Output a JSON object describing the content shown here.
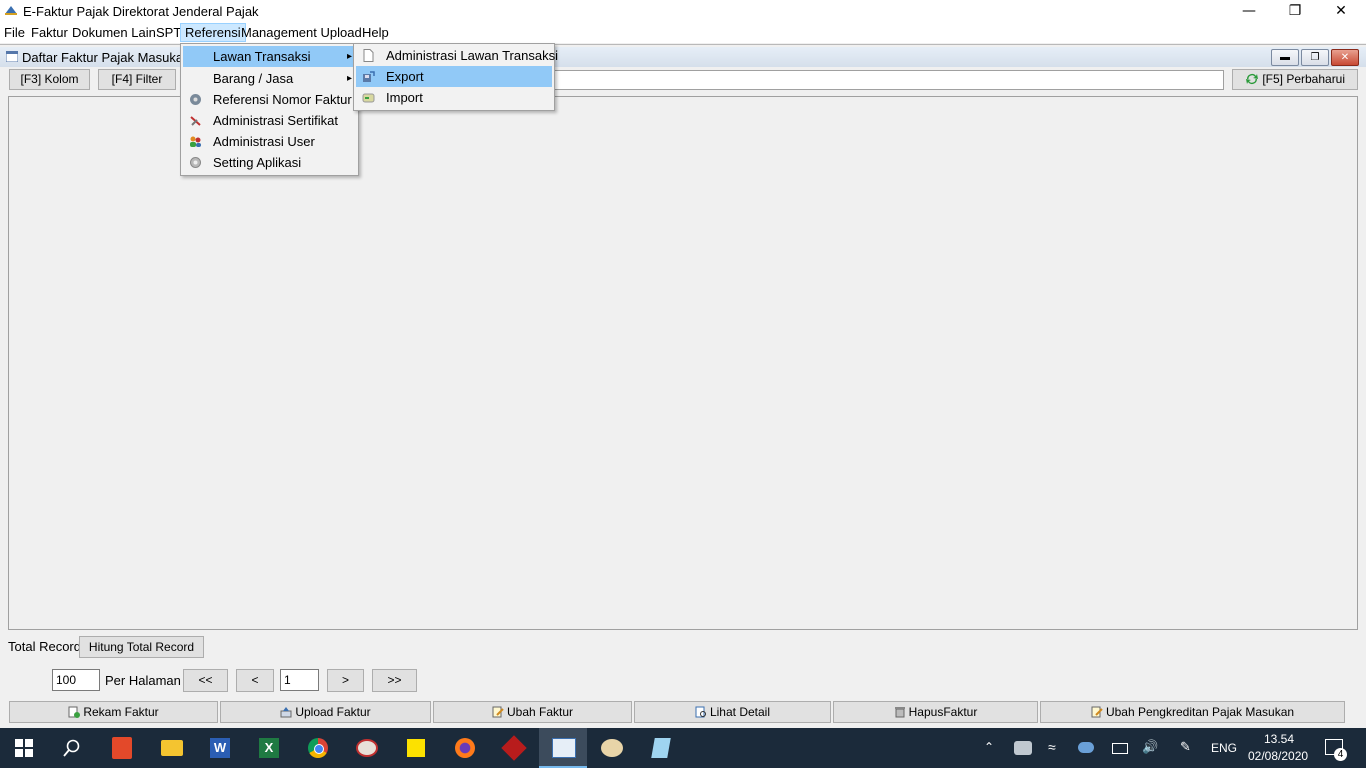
{
  "window": {
    "title": "E-Faktur Pajak Direktorat Jenderal Pajak"
  },
  "menubar": [
    {
      "label": "File"
    },
    {
      "label": "Faktur"
    },
    {
      "label": "Dokumen Lain"
    },
    {
      "label": "SPT"
    },
    {
      "label": "Referensi"
    },
    {
      "label": "Management Upload"
    },
    {
      "label": "Help"
    }
  ],
  "frame": {
    "title": "Daftar Faktur Pajak Masukan"
  },
  "toolbar": {
    "kolom": "[F3] Kolom",
    "filter": "[F4] Filter",
    "refresh": "[F5] Perbaharui"
  },
  "referensi_menu": [
    {
      "label": "Lawan Transaksi",
      "icon": "none",
      "submenu": true
    },
    {
      "label": "Barang / Jasa",
      "icon": "none",
      "submenu": true
    },
    {
      "label": "Referensi Nomor Faktur",
      "icon": "disk-icon"
    },
    {
      "label": "Administrasi Sertifikat",
      "icon": "tools-icon"
    },
    {
      "label": "Administrasi User",
      "icon": "users-icon"
    },
    {
      "label": "Setting Aplikasi",
      "icon": "gear-icon"
    }
  ],
  "lawan_submenu": [
    {
      "label": "Administrasi Lawan Transaksi",
      "icon": "document-icon"
    },
    {
      "label": "Export",
      "icon": "export-icon"
    },
    {
      "label": "Import",
      "icon": "import-icon"
    }
  ],
  "footer": {
    "total_record_label": "Total Record",
    "hitung_label": "Hitung Total Record",
    "per_page_value": "100",
    "per_halaman_label": "Per Halaman",
    "first": "<<",
    "prev": "<",
    "page_value": "1",
    "next": ">",
    "last": ">>"
  },
  "actions": [
    {
      "label": "Rekam Faktur"
    },
    {
      "label": "Upload Faktur"
    },
    {
      "label": "Ubah Faktur"
    },
    {
      "label": "Lihat Detail"
    },
    {
      "label": "HapusFaktur"
    },
    {
      "label": "Ubah Pengkreditan Pajak Masukan"
    }
  ],
  "taskbar": {
    "lang": "ENG",
    "time": "13.54",
    "date": "02/08/2020",
    "notif_count": "4"
  },
  "colors": {
    "menu_highlight": "#91c9f7",
    "taskbar": "#1b2a3a"
  }
}
